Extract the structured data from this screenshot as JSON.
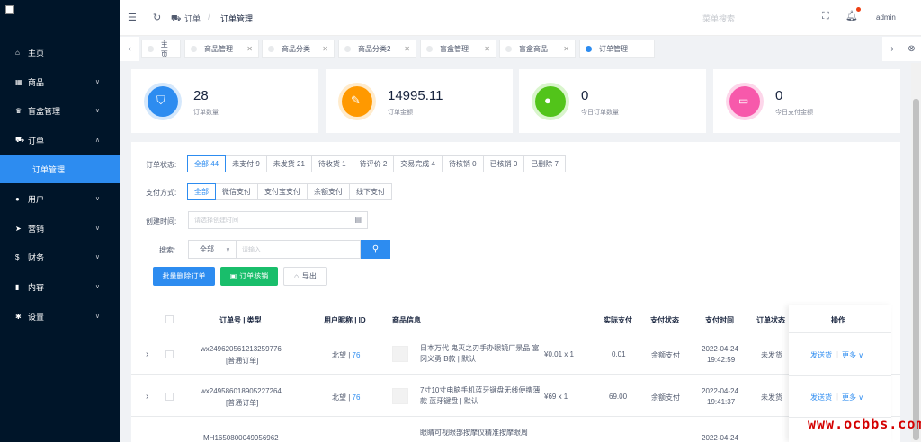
{
  "sidebar": {
    "items": [
      {
        "label": "主页",
        "icon": "home-icon"
      },
      {
        "label": "商品",
        "icon": "shop-icon"
      },
      {
        "label": "盲盒管理",
        "icon": "trophy-icon"
      },
      {
        "label": "订单",
        "icon": "cart-icon"
      },
      {
        "label": "订单管理"
      },
      {
        "label": "用户",
        "icon": "user-icon"
      },
      {
        "label": "营销",
        "icon": "send-icon"
      },
      {
        "label": "财务",
        "icon": "dollar-icon"
      },
      {
        "label": "内容",
        "icon": "book-icon"
      },
      {
        "label": "设置",
        "icon": "gear-icon"
      }
    ]
  },
  "header": {
    "breadcrumb_1": "订单",
    "separator": "/",
    "breadcrumb_2": "订单管理",
    "search_placeholder": "菜单搜索",
    "user": "admin"
  },
  "tabs": [
    {
      "label": "主页"
    },
    {
      "label": "商品管理"
    },
    {
      "label": "商品分类"
    },
    {
      "label": "商品分类2"
    },
    {
      "label": "盲盒管理"
    },
    {
      "label": "盲盒商品"
    },
    {
      "label": "订单管理"
    }
  ],
  "stats": [
    {
      "value": "28",
      "label": "订单数量",
      "color": "#2d8cf0"
    },
    {
      "value": "14995.11",
      "label": "订单金额",
      "color": "#ff9900"
    },
    {
      "value": "0",
      "label": "今日订单数量",
      "color": "#19be6b"
    },
    {
      "value": "0",
      "label": "今日支付金额",
      "color": "#ed4f9e"
    }
  ],
  "filters": {
    "status_label": "订单状态:",
    "status_options": [
      "全部 44",
      "未支付 9",
      "未发货 21",
      "待收货 1",
      "待评价 2",
      "交易完成 4",
      "待核销 0",
      "已核销 0",
      "已删除 7"
    ],
    "pay_label": "支付方式:",
    "pay_options": [
      "全部",
      "微信支付",
      "支付宝支付",
      "余额支付",
      "线下支付"
    ],
    "time_label": "创建时间:",
    "time_placeholder": "请选择创建时间",
    "search_label": "搜索:",
    "search_select": "全部",
    "search_placeholder": "请输入"
  },
  "actions": {
    "batch_delete": "批量删除订单",
    "verify": "订单核销",
    "export": "导出"
  },
  "table": {
    "headers": [
      "订单号 | 类型",
      "用户昵称 | ID",
      "商品信息",
      "实际支付",
      "支付状态",
      "支付时间",
      "订单状态",
      "操作"
    ],
    "rows": [
      {
        "order_no": "wx249620561213259776",
        "type": "[普通订单]",
        "user": "北望",
        "uid": "76",
        "product": "日本万代 鬼灭之刃手办眼镜厂景品 富冈义勇 B款 | 默认",
        "price": "¥0.01 x 1",
        "paid": "0.01",
        "pay_status": "余额支付",
        "pay_date": "2022-04-24",
        "pay_time": "19:42:59",
        "order_status": "未发货",
        "op_ship": "发送货",
        "op_more": "更多"
      },
      {
        "order_no": "wx249586018905227264",
        "type": "[普通订单]",
        "user": "北望",
        "uid": "76",
        "product": "7寸10寸电脑手机蓝牙键盘无线便携薄款 蓝牙键盘 | 默认",
        "price": "¥69 x 1",
        "paid": "69.00",
        "pay_status": "余额支付",
        "pay_date": "2022-04-24",
        "pay_time": "19:41:37",
        "order_status": "未发货",
        "op_ship": "发送货",
        "op_more": "更多"
      },
      {
        "order_no": "MH1650800049956962",
        "type": "",
        "user": "",
        "uid": "",
        "product": "眼睛可视眼部按摩仪精准按摩眼周",
        "price": "",
        "paid": "",
        "pay_status": "",
        "pay_date": "2022-04-24",
        "pay_time": "",
        "order_status": "",
        "op_ship": "",
        "op_more": ""
      }
    ]
  },
  "watermark": "www.ocbbs.com"
}
